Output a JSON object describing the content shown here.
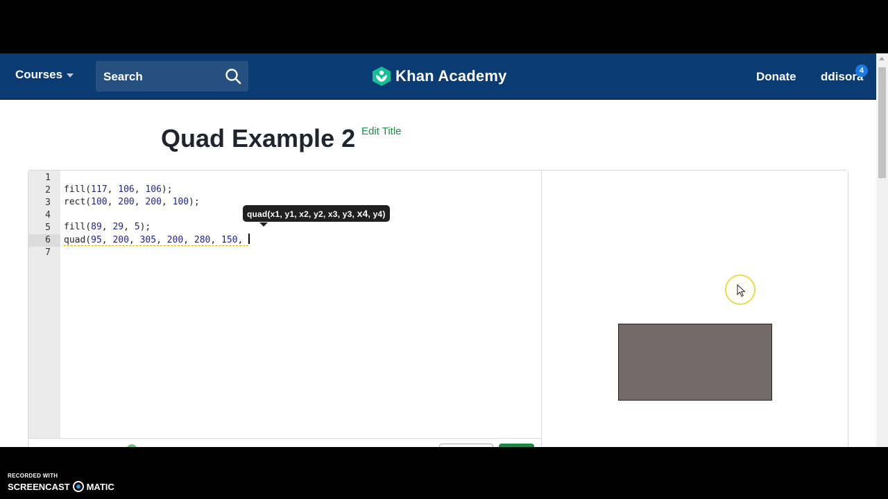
{
  "nav": {
    "courses_label": "Courses",
    "search_label": "Search",
    "brand": "Khan Academy",
    "donate_label": "Donate",
    "username": "ddisora",
    "notification_count": "4"
  },
  "page": {
    "title": "Quad Example 2",
    "edit_title_label": "Edit Title"
  },
  "editor": {
    "line_numbers": [
      "1",
      "2",
      "3",
      "4",
      "5",
      "6",
      "7"
    ],
    "active_line": 6,
    "lines": [
      "",
      "fill(117, 106, 106);",
      "rect(100, 200, 200, 100);",
      "",
      "fill(89, 29, 5);",
      "quad(95, 200, 305, 200, 280, 150, ",
      ""
    ],
    "tooltip": {
      "prefix": "quad(x1, y1, x2, y2, x3, y3, ",
      "current_param": "x4",
      "suffix": ", y4)"
    }
  },
  "canvas": {
    "shape_fill": "#756a6a"
  },
  "footer": {
    "recorded_with": "RECORDED WITH",
    "brand_left": "SCREENCAST",
    "brand_right": "MATIC"
  },
  "colors": {
    "navbar": "#0a3b73",
    "accent_green": "#1e8747",
    "number_blue": "#1c1f9a"
  }
}
